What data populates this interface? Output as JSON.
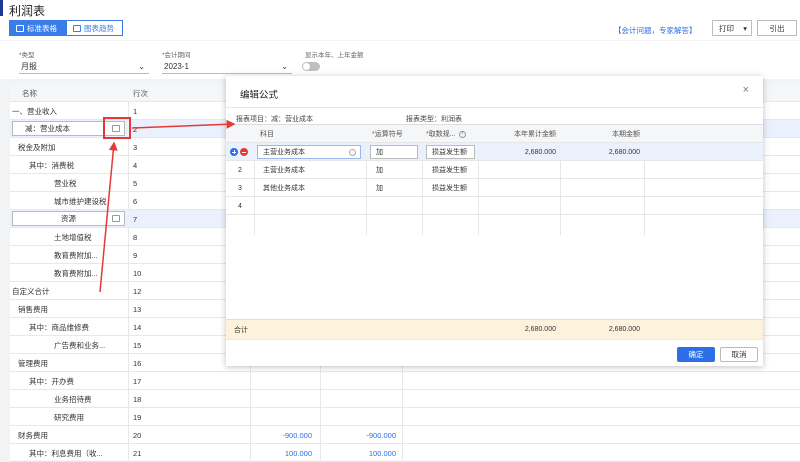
{
  "page": {
    "title": "利润表"
  },
  "tabs": [
    {
      "label": "标准表格",
      "icon": "table-icon",
      "active": true
    },
    {
      "label": "图表趋势",
      "icon": "chart-icon",
      "active": false
    }
  ],
  "header": {
    "help_link": "【会计问题，专家解答】",
    "print_label": "打印",
    "export_label": "引出"
  },
  "filters": {
    "type": {
      "label": "类型",
      "value": "月报"
    },
    "period": {
      "label": "会计期间",
      "value": "2023-1"
    },
    "show_current_year": {
      "label": "显示本年、上年金额",
      "on": false
    }
  },
  "grid": {
    "headers": {
      "name": "名称",
      "row_no": "行次"
    },
    "rows": [
      {
        "name": "一、营业收入",
        "no": "1",
        "indent": 0,
        "v1": "",
        "v2": ""
      },
      {
        "name": "减：营业成本",
        "no": "2",
        "indent": 1,
        "v1": "",
        "v2": "",
        "editing": true
      },
      {
        "name": "税金及附加",
        "no": "3",
        "indent": 1,
        "v1": "",
        "v2": ""
      },
      {
        "name": "其中：消费税",
        "no": "4",
        "indent": 2,
        "v1": "",
        "v2": ""
      },
      {
        "name": "营业税",
        "no": "5",
        "indent": 3,
        "v1": "",
        "v2": ""
      },
      {
        "name": "城市维护建设税",
        "no": "6",
        "indent": 3,
        "v1": "",
        "v2": ""
      },
      {
        "name": "资源",
        "no": "7",
        "indent": 3,
        "v1": "",
        "v2": "",
        "editing": true
      },
      {
        "name": "土地增值税",
        "no": "8",
        "indent": 3,
        "v1": "",
        "v2": ""
      },
      {
        "name": "教育费附加...",
        "no": "9",
        "indent": 3,
        "v1": "",
        "v2": ""
      },
      {
        "name": "教育费附加...",
        "no": "10",
        "indent": 3,
        "v1": "",
        "v2": ""
      },
      {
        "name": "自定义合计",
        "no": "12",
        "indent": 0,
        "v1": "",
        "v2": ""
      },
      {
        "name": "销售费用",
        "no": "13",
        "indent": 1,
        "v1": "",
        "v2": ""
      },
      {
        "name": "其中：商品维修费",
        "no": "14",
        "indent": 2,
        "v1": "",
        "v2": ""
      },
      {
        "name": "广告费和业务...",
        "no": "15",
        "indent": 3,
        "v1": "",
        "v2": ""
      },
      {
        "name": "管理费用",
        "no": "16",
        "indent": 1,
        "v1": "",
        "v2": ""
      },
      {
        "name": "其中：开办费",
        "no": "17",
        "indent": 2,
        "v1": "",
        "v2": ""
      },
      {
        "name": "业务招待费",
        "no": "18",
        "indent": 3,
        "v1": "",
        "v2": ""
      },
      {
        "name": "研究费用",
        "no": "19",
        "indent": 3,
        "v1": "",
        "v2": ""
      },
      {
        "name": "财务费用",
        "no": "20",
        "indent": 1,
        "v1": "-900.000",
        "v2": "-900.000"
      },
      {
        "name": "其中：利息费用（收...",
        "no": "21",
        "indent": 2,
        "v1": "100.000",
        "v2": "100.000"
      }
    ]
  },
  "modal": {
    "title": "编辑公式",
    "close_glyph": "×",
    "project_info": "报表项目：减：营业成本",
    "report_type_info": "报表类型：利润表",
    "columns": {
      "subject": "科目",
      "operator": "运算符号",
      "rule": "取数规...",
      "ytd": "本年累计金额",
      "current": "本期金额"
    },
    "rows": [
      {
        "no": "1",
        "subject": "主营业务成本",
        "operator": "加",
        "rule": "损益发生额",
        "ytd": "2,680.000",
        "current": "2,680.000"
      },
      {
        "no": "2",
        "subject": "主营业务成本",
        "operator": "加",
        "rule": "损益发生额",
        "ytd": "",
        "current": ""
      },
      {
        "no": "3",
        "subject": "其他业务成本",
        "operator": "加",
        "rule": "损益发生额",
        "ytd": "",
        "current": ""
      },
      {
        "no": "4",
        "subject": "",
        "operator": "",
        "rule": "",
        "ytd": "",
        "current": ""
      }
    ],
    "total": {
      "label": "合计",
      "ytd": "2,680.000",
      "current": "2,680.000"
    },
    "ok_label": "确定",
    "cancel_label": "取消"
  },
  "colors": {
    "accent": "#3a7ce8",
    "annotation": "#e53935",
    "total_row": "#fdf3dd"
  }
}
